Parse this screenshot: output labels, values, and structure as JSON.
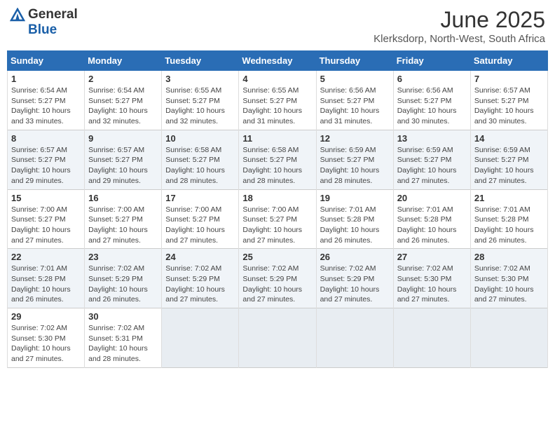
{
  "header": {
    "logo_general": "General",
    "logo_blue": "Blue",
    "title": "June 2025",
    "subtitle": "Klerksdorp, North-West, South Africa"
  },
  "days_of_week": [
    "Sunday",
    "Monday",
    "Tuesday",
    "Wednesday",
    "Thursday",
    "Friday",
    "Saturday"
  ],
  "weeks": [
    [
      {
        "num": "1",
        "info": "Sunrise: 6:54 AM\nSunset: 5:27 PM\nDaylight: 10 hours\nand 33 minutes."
      },
      {
        "num": "2",
        "info": "Sunrise: 6:54 AM\nSunset: 5:27 PM\nDaylight: 10 hours\nand 32 minutes."
      },
      {
        "num": "3",
        "info": "Sunrise: 6:55 AM\nSunset: 5:27 PM\nDaylight: 10 hours\nand 32 minutes."
      },
      {
        "num": "4",
        "info": "Sunrise: 6:55 AM\nSunset: 5:27 PM\nDaylight: 10 hours\nand 31 minutes."
      },
      {
        "num": "5",
        "info": "Sunrise: 6:56 AM\nSunset: 5:27 PM\nDaylight: 10 hours\nand 31 minutes."
      },
      {
        "num": "6",
        "info": "Sunrise: 6:56 AM\nSunset: 5:27 PM\nDaylight: 10 hours\nand 30 minutes."
      },
      {
        "num": "7",
        "info": "Sunrise: 6:57 AM\nSunset: 5:27 PM\nDaylight: 10 hours\nand 30 minutes."
      }
    ],
    [
      {
        "num": "8",
        "info": "Sunrise: 6:57 AM\nSunset: 5:27 PM\nDaylight: 10 hours\nand 29 minutes."
      },
      {
        "num": "9",
        "info": "Sunrise: 6:57 AM\nSunset: 5:27 PM\nDaylight: 10 hours\nand 29 minutes."
      },
      {
        "num": "10",
        "info": "Sunrise: 6:58 AM\nSunset: 5:27 PM\nDaylight: 10 hours\nand 28 minutes."
      },
      {
        "num": "11",
        "info": "Sunrise: 6:58 AM\nSunset: 5:27 PM\nDaylight: 10 hours\nand 28 minutes."
      },
      {
        "num": "12",
        "info": "Sunrise: 6:59 AM\nSunset: 5:27 PM\nDaylight: 10 hours\nand 28 minutes."
      },
      {
        "num": "13",
        "info": "Sunrise: 6:59 AM\nSunset: 5:27 PM\nDaylight: 10 hours\nand 27 minutes."
      },
      {
        "num": "14",
        "info": "Sunrise: 6:59 AM\nSunset: 5:27 PM\nDaylight: 10 hours\nand 27 minutes."
      }
    ],
    [
      {
        "num": "15",
        "info": "Sunrise: 7:00 AM\nSunset: 5:27 PM\nDaylight: 10 hours\nand 27 minutes."
      },
      {
        "num": "16",
        "info": "Sunrise: 7:00 AM\nSunset: 5:27 PM\nDaylight: 10 hours\nand 27 minutes."
      },
      {
        "num": "17",
        "info": "Sunrise: 7:00 AM\nSunset: 5:27 PM\nDaylight: 10 hours\nand 27 minutes."
      },
      {
        "num": "18",
        "info": "Sunrise: 7:00 AM\nSunset: 5:27 PM\nDaylight: 10 hours\nand 27 minutes."
      },
      {
        "num": "19",
        "info": "Sunrise: 7:01 AM\nSunset: 5:28 PM\nDaylight: 10 hours\nand 26 minutes."
      },
      {
        "num": "20",
        "info": "Sunrise: 7:01 AM\nSunset: 5:28 PM\nDaylight: 10 hours\nand 26 minutes."
      },
      {
        "num": "21",
        "info": "Sunrise: 7:01 AM\nSunset: 5:28 PM\nDaylight: 10 hours\nand 26 minutes."
      }
    ],
    [
      {
        "num": "22",
        "info": "Sunrise: 7:01 AM\nSunset: 5:28 PM\nDaylight: 10 hours\nand 26 minutes."
      },
      {
        "num": "23",
        "info": "Sunrise: 7:02 AM\nSunset: 5:29 PM\nDaylight: 10 hours\nand 26 minutes."
      },
      {
        "num": "24",
        "info": "Sunrise: 7:02 AM\nSunset: 5:29 PM\nDaylight: 10 hours\nand 27 minutes."
      },
      {
        "num": "25",
        "info": "Sunrise: 7:02 AM\nSunset: 5:29 PM\nDaylight: 10 hours\nand 27 minutes."
      },
      {
        "num": "26",
        "info": "Sunrise: 7:02 AM\nSunset: 5:29 PM\nDaylight: 10 hours\nand 27 minutes."
      },
      {
        "num": "27",
        "info": "Sunrise: 7:02 AM\nSunset: 5:30 PM\nDaylight: 10 hours\nand 27 minutes."
      },
      {
        "num": "28",
        "info": "Sunrise: 7:02 AM\nSunset: 5:30 PM\nDaylight: 10 hours\nand 27 minutes."
      }
    ],
    [
      {
        "num": "29",
        "info": "Sunrise: 7:02 AM\nSunset: 5:30 PM\nDaylight: 10 hours\nand 27 minutes."
      },
      {
        "num": "30",
        "info": "Sunrise: 7:02 AM\nSunset: 5:31 PM\nDaylight: 10 hours\nand 28 minutes."
      },
      {
        "num": "",
        "info": ""
      },
      {
        "num": "",
        "info": ""
      },
      {
        "num": "",
        "info": ""
      },
      {
        "num": "",
        "info": ""
      },
      {
        "num": "",
        "info": ""
      }
    ]
  ]
}
